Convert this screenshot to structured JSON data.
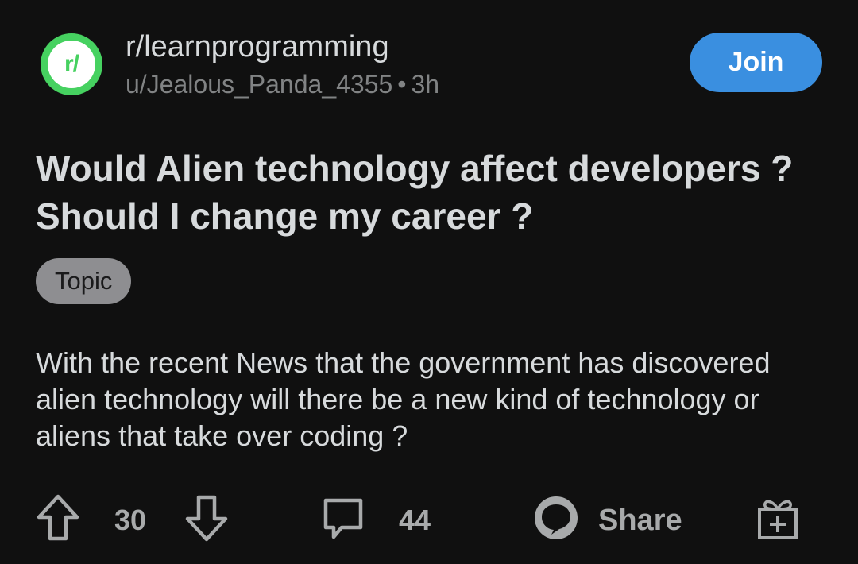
{
  "post": {
    "subreddit": "r/learnprogramming",
    "subreddit_icon_text": "r/",
    "author": "u/Jealous_Panda_4355",
    "separator": "•",
    "age": "3h",
    "join_label": "Join",
    "title": "Would Alien technology affect developers ? Should I change my career ?",
    "flair": "Topic",
    "body": "With the recent News that the government has discovered alien technology will there be a new kind of technology or aliens that take over coding ?"
  },
  "actions": {
    "upvote_icon": "upvote-arrow-icon",
    "score": "30",
    "downvote_icon": "downvote-arrow-icon",
    "comment_icon": "comment-bubble-icon",
    "comments": "44",
    "share_icon": "share-icon",
    "share_label": "Share",
    "award_icon": "gift-award-icon"
  },
  "colors": {
    "background": "#101010",
    "accent": "#3a8fe0",
    "subreddit_brand": "#46d160",
    "text": "#d7dadc",
    "muted": "#818384",
    "flair_bg": "#8e8e91"
  }
}
